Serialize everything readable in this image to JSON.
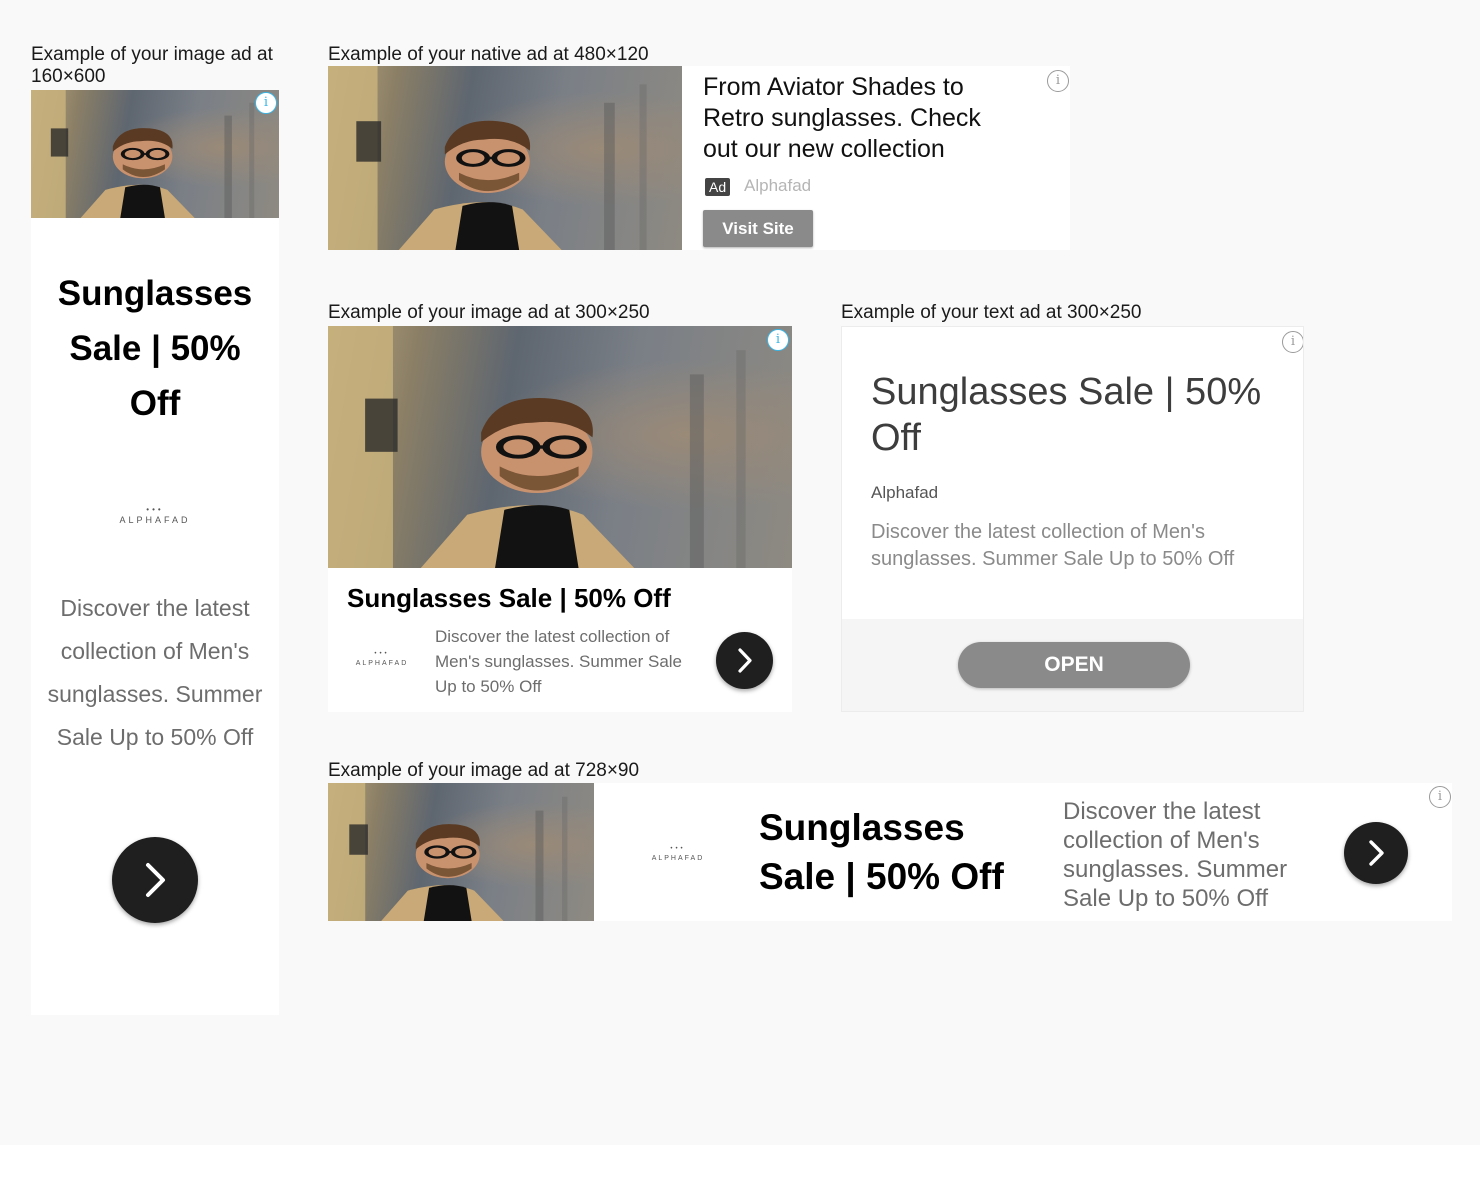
{
  "captions": {
    "ad160": "Example of your image ad at 160×600",
    "native": "Example of your native ad at 480×120",
    "img300": "Example of your image ad at 300×250",
    "text300": "Example of your text ad at 300×250",
    "img728": "Example of your image ad at 728×90"
  },
  "ad160": {
    "headline": "Sunglasses Sale | 50% Off",
    "logo": "ALPHAFAD",
    "description": "Discover the latest collection of Men's sunglasses. Summer Sale Up to 50% Off",
    "info_icon": "info-icon",
    "cta_icon": "chevron-right-icon"
  },
  "native": {
    "headline": "From Aviator Shades to Retro sunglasses. Check out our new collection",
    "ad_badge": "Ad",
    "advertiser": "Alphafad",
    "cta": "Visit Site"
  },
  "img300": {
    "headline": "Sunglasses Sale | 50% Off",
    "logo": "ALPHAFAD",
    "description": "Discover the latest collection of Men's sunglasses. Summer Sale Up to 50% Off"
  },
  "text300": {
    "headline": "Sunglasses Sale | 50% Off",
    "advertiser": "Alphafad",
    "description": "Discover the latest collection of Men's sunglasses. Summer Sale Up to 50% Off",
    "cta": "OPEN"
  },
  "img728": {
    "headline": "Sunglasses Sale | 50% Off",
    "logo": "ALPHAFAD",
    "description": "Discover the latest collection of Men's sunglasses. Summer Sale Up to 50% Off"
  },
  "colors": {
    "accent_info": "#36b6e8",
    "button_dark": "#1f1f1f",
    "button_grey": "#8a8a8a"
  }
}
